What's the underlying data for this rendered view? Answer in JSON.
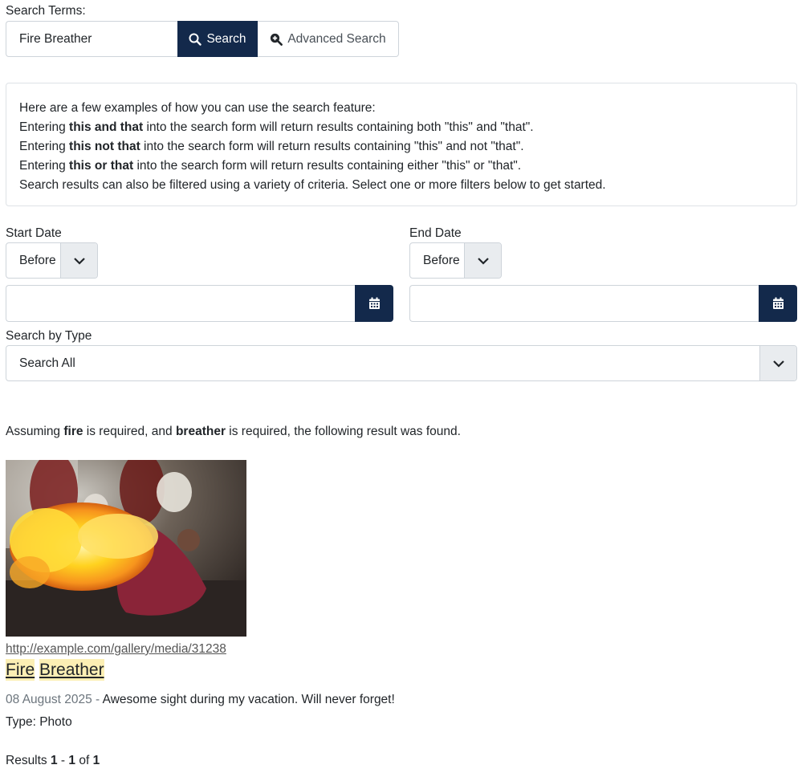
{
  "search": {
    "label": "Search Terms:",
    "value": "Fire Breather",
    "search_button": "Search",
    "advanced_button": "Advanced Search"
  },
  "help": {
    "intro": "Here are a few examples of how you can use the search feature:",
    "examples": [
      {
        "prefix": "Entering ",
        "term": "this and that",
        "suffix": " into the search form will return results containing both \"this\" and \"that\"."
      },
      {
        "prefix": "Entering ",
        "term": "this not that",
        "suffix": " into the search form will return results containing \"this\" and not \"that\"."
      },
      {
        "prefix": "Entering ",
        "term": "this or that",
        "suffix": " into the search form will return results containing either \"this\" or \"that\"."
      }
    ],
    "filter_note": "Search results can also be filtered using a variety of criteria. Select one or more filters below to get started."
  },
  "filters": {
    "start_date": {
      "label": "Start Date",
      "mode": "Before",
      "value": ""
    },
    "end_date": {
      "label": "End Date",
      "mode": "Before",
      "value": ""
    },
    "type": {
      "label": "Search by Type",
      "value": "Search All"
    }
  },
  "summary": {
    "prefix": "Assuming ",
    "term1": "fire",
    "middle": " is required, and ",
    "term2": "breather",
    "suffix": " is required, the following result was found."
  },
  "result": {
    "url": "http://example.com/gallery/media/31238",
    "title_words": [
      "Fire",
      "Breather"
    ],
    "date": "08 August 2025",
    "separator": " - ",
    "description": "Awesome sight during my vacation. Will never forget!",
    "type_label": "Type: ",
    "type_value": "Photo"
  },
  "pagination": {
    "prefix": "Results ",
    "start": "1",
    "dash": " - ",
    "end": "1",
    "of": " of ",
    "total": "1"
  },
  "colors": {
    "primary": "#13294b",
    "highlight": "#fcefb4"
  }
}
